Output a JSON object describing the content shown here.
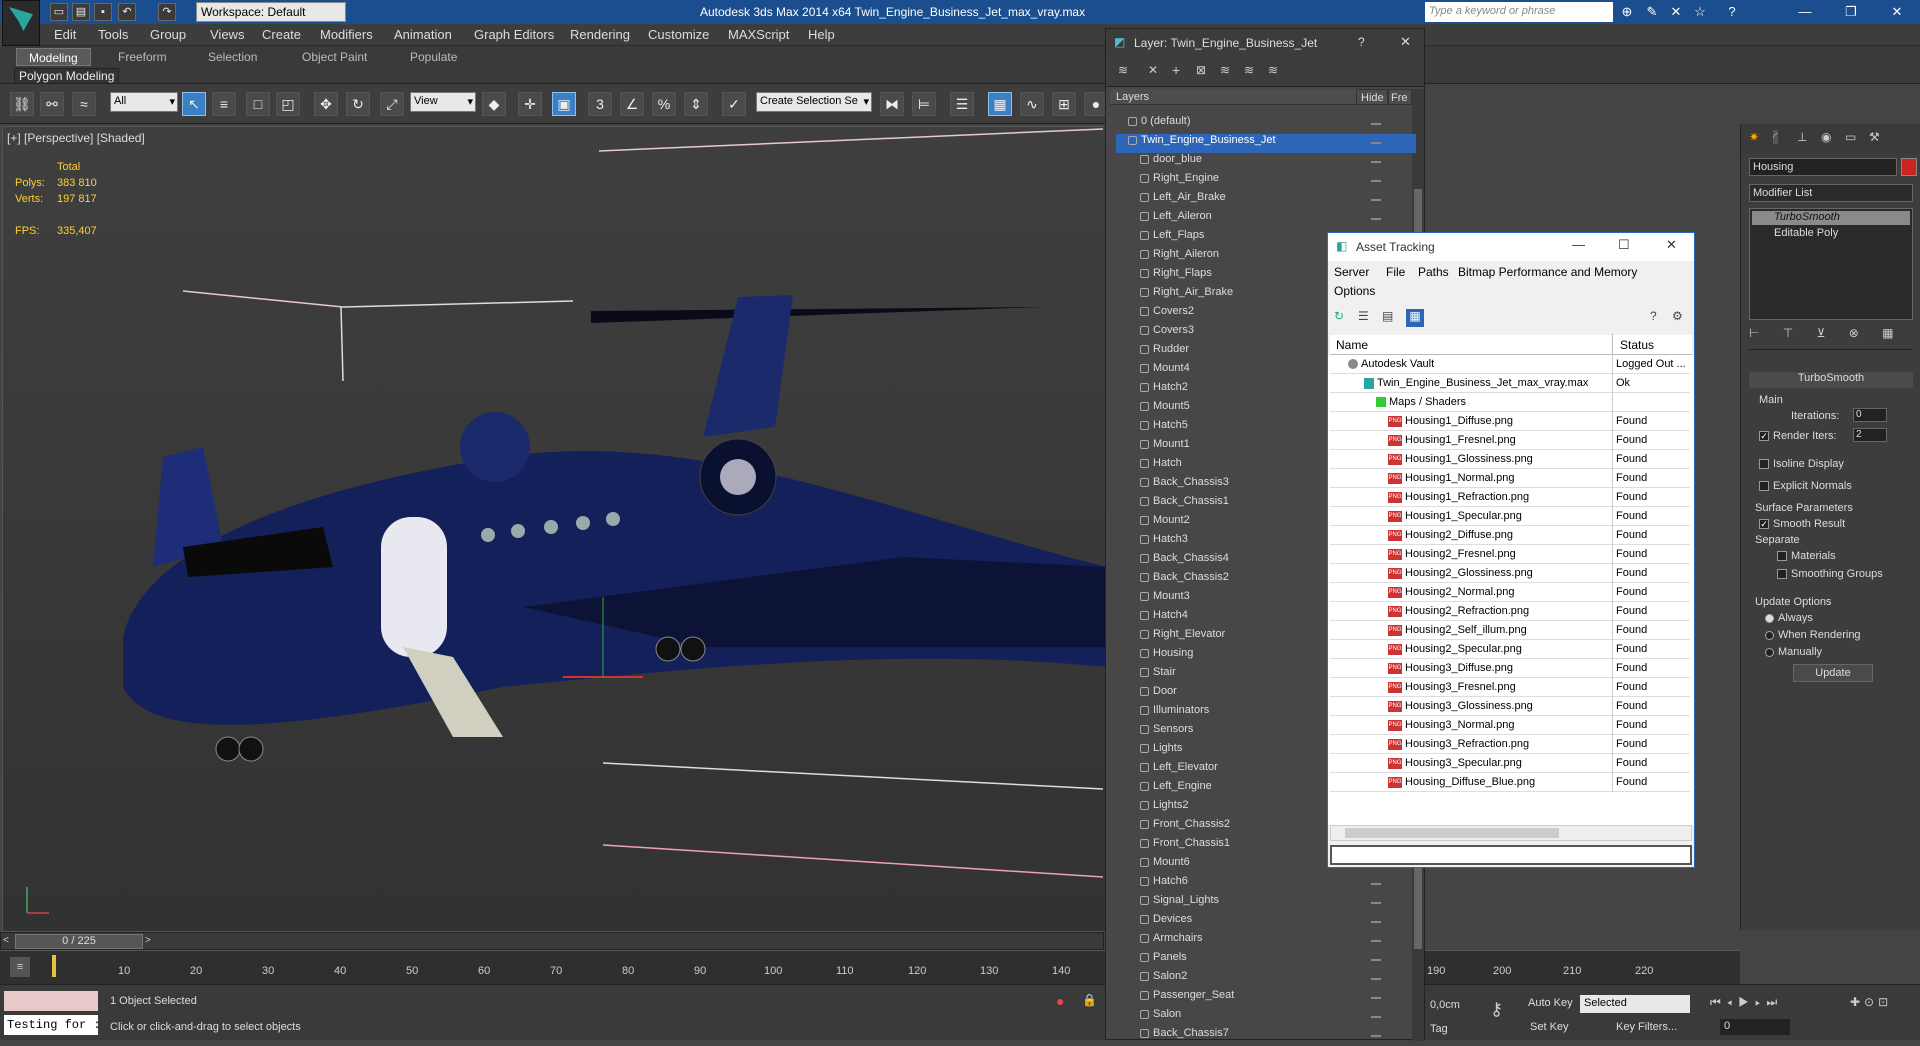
{
  "titlebar": {
    "title": "Autodesk 3ds Max  2014 x64     Twin_Engine_Business_Jet_max_vray.max",
    "workspace": "Workspace: Default",
    "search_placeholder": "Type a keyword or phrase",
    "accent": "#1a4e8f"
  },
  "menu": [
    "Edit",
    "Tools",
    "Group",
    "Views",
    "Create",
    "Modifiers",
    "Animation",
    "Graph Editors",
    "Rendering",
    "Customize",
    "MAXScript",
    "Help"
  ],
  "ribbon": {
    "tabs": [
      "Modeling",
      "Freeform",
      "Selection",
      "Object Paint",
      "Populate"
    ],
    "sub": "Polygon Modeling"
  },
  "toolbar": {
    "filter": "All",
    "refcoord": "View",
    "selset": "Create Selection Se"
  },
  "viewport": {
    "label": "[+] [Perspective] [Shaded]",
    "stats": {
      "total": "Total",
      "polys_label": "Polys:",
      "polys": "383 810",
      "verts_label": "Verts:",
      "verts": "197 817",
      "fps_label": "FPS:",
      "fps": "335,407"
    }
  },
  "timeline": {
    "frame": "0 / 225",
    "ticks": [
      "10",
      "20",
      "30",
      "40",
      "50",
      "60",
      "70",
      "80",
      "90",
      "100",
      "110",
      "120",
      "130",
      "140",
      "190",
      "200",
      "210",
      "220"
    ]
  },
  "layers": {
    "title": "Layer: Twin_Engine_Business_Jet",
    "col_layers": "Layers",
    "col_hide": "Hide",
    "col_freeze": "Fre",
    "items": [
      "0 (default)",
      "Twin_Engine_Business_Jet",
      "door_blue",
      "Right_Engine",
      "Left_Air_Brake",
      "Left_Aileron",
      "Left_Flaps",
      "Right_Aileron",
      "Right_Flaps",
      "Right_Air_Brake",
      "Covers2",
      "Covers3",
      "Rudder",
      "Mount4",
      "Hatch2",
      "Mount5",
      "Hatch5",
      "Mount1",
      "Hatch",
      "Back_Chassis3",
      "Back_Chassis1",
      "Mount2",
      "Hatch3",
      "Back_Chassis4",
      "Back_Chassis2",
      "Mount3",
      "Hatch4",
      "Right_Elevator",
      "Housing",
      "Stair",
      "Door",
      "Illuminators",
      "Sensors",
      "Lights",
      "Left_Elevator",
      "Left_Engine",
      "Lights2",
      "Front_Chassis2",
      "Front_Chassis1",
      "Mount6",
      "Hatch6",
      "Signal_Lights",
      "Devices",
      "Armchairs",
      "Panels",
      "Salon2",
      "Passenger_Seat",
      "Salon",
      "Back_Chassis7"
    ]
  },
  "asset": {
    "title": "Asset Tracking",
    "menu": [
      "Server",
      "File",
      "Paths",
      "Bitmap Performance and Memory"
    ],
    "options": "Options",
    "col_name": "Name",
    "col_status": "Status",
    "rows": [
      {
        "name": "Autodesk Vault",
        "status": "Logged Out ..."
      },
      {
        "name": "Twin_Engine_Business_Jet_max_vray.max",
        "status": "Ok"
      },
      {
        "name": "Maps / Shaders",
        "status": ""
      },
      {
        "name": "Housing1_Diffuse.png",
        "status": "Found"
      },
      {
        "name": "Housing1_Fresnel.png",
        "status": "Found"
      },
      {
        "name": "Housing1_Glossiness.png",
        "status": "Found"
      },
      {
        "name": "Housing1_Normal.png",
        "status": "Found"
      },
      {
        "name": "Housing1_Refraction.png",
        "status": "Found"
      },
      {
        "name": "Housing1_Specular.png",
        "status": "Found"
      },
      {
        "name": "Housing2_Diffuse.png",
        "status": "Found"
      },
      {
        "name": "Housing2_Fresnel.png",
        "status": "Found"
      },
      {
        "name": "Housing2_Glossiness.png",
        "status": "Found"
      },
      {
        "name": "Housing2_Normal.png",
        "status": "Found"
      },
      {
        "name": "Housing2_Refraction.png",
        "status": "Found"
      },
      {
        "name": "Housing2_Self_illum.png",
        "status": "Found"
      },
      {
        "name": "Housing2_Specular.png",
        "status": "Found"
      },
      {
        "name": "Housing3_Diffuse.png",
        "status": "Found"
      },
      {
        "name": "Housing3_Fresnel.png",
        "status": "Found"
      },
      {
        "name": "Housing3_Glossiness.png",
        "status": "Found"
      },
      {
        "name": "Housing3_Normal.png",
        "status": "Found"
      },
      {
        "name": "Housing3_Refraction.png",
        "status": "Found"
      },
      {
        "name": "Housing3_Specular.png",
        "status": "Found"
      },
      {
        "name": "Housing_Diffuse_Blue.png",
        "status": "Found"
      }
    ]
  },
  "cmd": {
    "object_name": "Housing",
    "object_color": "#cc2222",
    "modifier_list": "Modifier List",
    "stack": [
      "TurboSmooth",
      "Editable Poly"
    ],
    "rollout": "TurboSmooth",
    "main": "Main",
    "iterations_label": "Iterations:",
    "iterations": "0",
    "render_iters_label": "Render Iters:",
    "render_iters": "2",
    "isoline": "Isoline Display",
    "explicit": "Explicit Normals",
    "surface": "Surface Parameters",
    "smooth": "Smooth Result",
    "separate": "Separate",
    "materials": "Materials",
    "smoothing_groups": "Smoothing Groups",
    "update_options": "Update Options",
    "always": "Always",
    "when_rendering": "When Rendering",
    "manually": "Manually",
    "update": "Update"
  },
  "status": {
    "selected": "1 Object Selected",
    "hint": "Click or click-and-drag to select objects",
    "script": "Testing for :",
    "coord": "0,0cm",
    "tag": "Tag",
    "autokey": "Auto Key",
    "setkey": "Set Key",
    "keymode": "Selected",
    "keyfilters": "Key Filters...",
    "frame_field": "0"
  }
}
